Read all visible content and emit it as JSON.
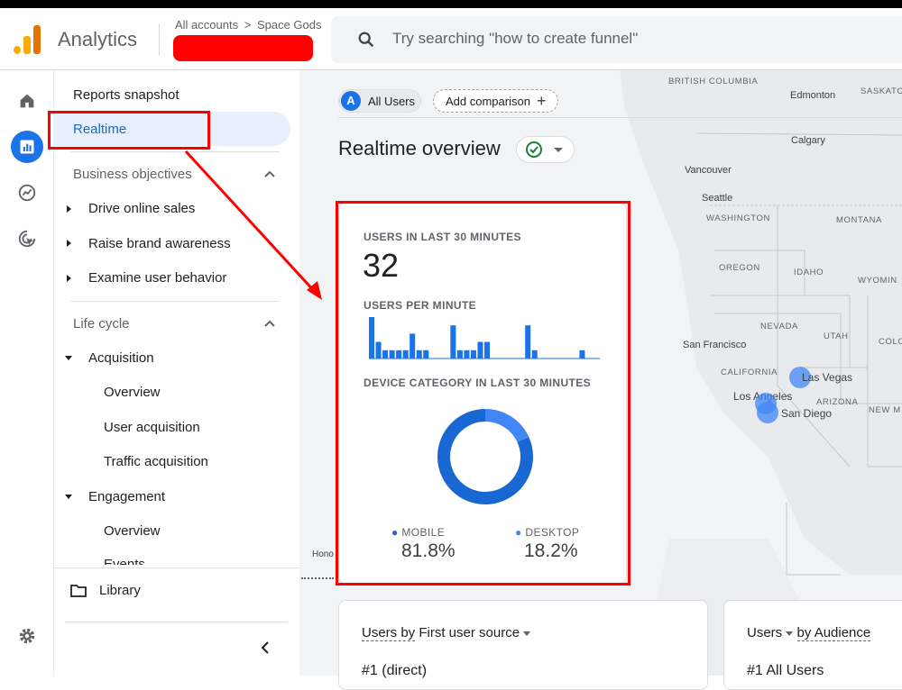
{
  "header": {
    "app_name": "Analytics",
    "breadcrumb_all": "All accounts",
    "breadcrumb_account": "Space Gods",
    "search_placeholder": "Try searching \"how to create funnel\""
  },
  "sidebar": {
    "reports_snapshot": "Reports snapshot",
    "realtime": "Realtime",
    "business_objectives": "Business objectives",
    "bo_items": [
      "Drive online sales",
      "Raise brand awareness",
      "Examine user behavior"
    ],
    "life_cycle": "Life cycle",
    "acquisition": "Acquisition",
    "acq_items": [
      "Overview",
      "User acquisition",
      "Traffic acquisition"
    ],
    "engagement": "Engagement",
    "eng_items": [
      "Overview",
      "Events"
    ],
    "library": "Library"
  },
  "toolbar": {
    "avatar_letter": "A",
    "all_users": "All Users",
    "add_comparison": "Add comparison",
    "page_title": "Realtime overview"
  },
  "realtime_card": {
    "users_30_label": "USERS IN LAST 30 MINUTES",
    "users_30_value": "32",
    "per_minute_label": "USERS PER MINUTE",
    "device_label": "DEVICE CATEGORY IN LAST 30 MINUTES",
    "mobile_label": "MOBILE",
    "mobile_value": "81.8%",
    "desktop_label": "DESKTOP",
    "desktop_value": "18.2%"
  },
  "chart_data": [
    {
      "type": "bar",
      "title": "USERS PER MINUTE",
      "values": [
        5,
        2,
        1,
        1,
        1,
        1,
        3,
        1,
        1,
        0,
        0,
        0,
        4,
        1,
        1,
        1,
        2,
        2,
        0,
        0,
        0,
        0,
        0,
        4,
        1,
        0,
        0,
        0,
        0,
        0,
        0,
        1,
        0,
        0
      ]
    },
    {
      "type": "pie",
      "title": "DEVICE CATEGORY IN LAST 30 MINUTES",
      "labels": [
        "MOBILE",
        "DESKTOP"
      ],
      "values": [
        81.8,
        18.2
      ],
      "colors": [
        "#1967d2",
        "#4285f4"
      ]
    }
  ],
  "bottom_cards": {
    "card1_metric": "Users by",
    "card1_dim": "First user source",
    "card1_row": "#1  (direct)",
    "card2_metric": "Users",
    "card2_dim": "by Audience",
    "card2_row": "#1  All Users"
  },
  "map": {
    "labels": {
      "british_columbia": "BRITISH COLUMBIA",
      "edmonton": "Edmonton",
      "saskatchewan": "SASKATC",
      "calgary": "Calgary",
      "vancouver": "Vancouver",
      "seattle": "Seattle",
      "washington": "WASHINGTON",
      "montana": "MONTANA",
      "oregon": "OREGON",
      "idaho": "IDAHO",
      "wyoming": "WYOMIN",
      "nevada": "NEVADA",
      "utah": "UTAH",
      "colorado": "COLO",
      "san_francisco": "San Francisco",
      "california": "CALIFORNIA",
      "las_vegas": "Las Vegas",
      "los_angeles": "Los Angeles",
      "arizona": "ARIZONA",
      "san_diego": "San Diego",
      "new_mexico": "NEW M",
      "honolulu": "Hono"
    }
  },
  "colors": {
    "accent": "#1a73e8",
    "annotation_red": "#ff0000",
    "highlight_bg": "#e8f0fe"
  }
}
